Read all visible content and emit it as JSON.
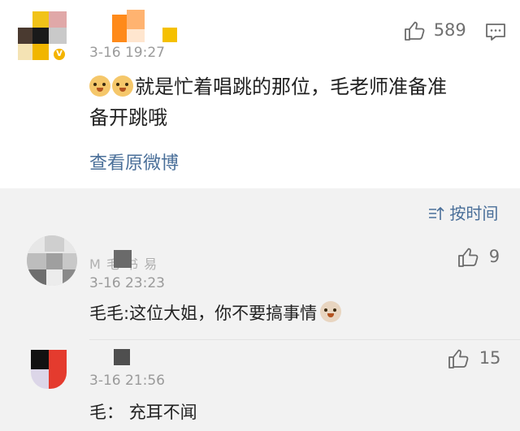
{
  "post": {
    "timestamp": "3-16 19:27",
    "like_count": "589",
    "text_line1": "就是忙着唱跳的那位，毛老师准备准",
    "text_line2": "备开跳哦",
    "emoji_names": [
      "doge-emoji",
      "doge-emoji"
    ],
    "view_original": "查看原微博"
  },
  "sort": {
    "label": "按时间"
  },
  "comments": [
    {
      "name_partial": "M  毛  书  易",
      "timestamp": "3-16 23:23",
      "like_count": "9",
      "text": "毛毛:这位大姐，你不要搞事情"
    },
    {
      "timestamp": "3-16 21:56",
      "like_count": "15",
      "text": "毛：  充耳不闻"
    }
  ],
  "icons": {
    "like": "thumbs-up-icon",
    "comment": "comment-icon",
    "sort": "sort-icon"
  },
  "colors": {
    "link": "#4a6f99",
    "timestamp": "#9a9a9a",
    "text": "#222222"
  }
}
